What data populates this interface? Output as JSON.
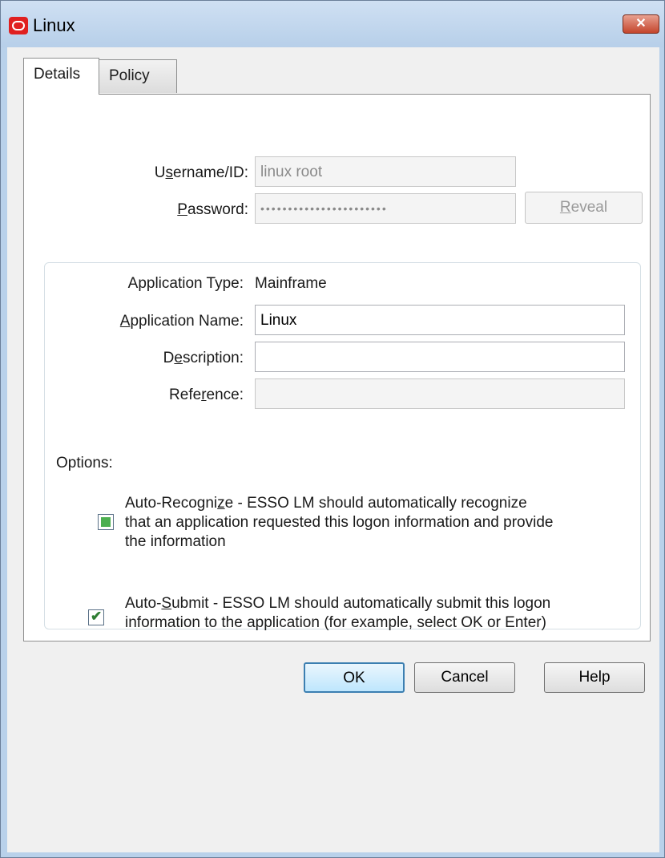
{
  "window": {
    "title": "Linux",
    "close_label": "✕"
  },
  "tabs": [
    {
      "label": "Details"
    },
    {
      "label": "Policy"
    }
  ],
  "details": {
    "username_label_pre": "U",
    "username_label_ul": "s",
    "username_label_post": "ername/ID:",
    "username_value": "linux root",
    "password_label_ul": "P",
    "password_label_post": "assword:",
    "password_value": "•••••••••••••••••••••••",
    "reveal_ul": "R",
    "reveal_post": "eveal"
  },
  "application": {
    "type_label": "Application Type:",
    "type_value": "Mainframe",
    "name_label_ul": "A",
    "name_label_post": "pplication Name:",
    "name_value": "Linux",
    "description_label_pre": "D",
    "description_label_ul": "e",
    "description_label_post": "scription:",
    "description_value": "",
    "reference_label_pre": "Refe",
    "reference_label_ul": "r",
    "reference_label_post": "ence:",
    "reference_value": ""
  },
  "options": {
    "heading": "Options:",
    "auto_recognize": {
      "line1_pre": "Auto-Recogni",
      "line1_ul": "z",
      "line1_post": "e - ESSO LM should automatically recognize",
      "line2": "that an application requested this logon information and provide",
      "line3": "the information",
      "state": "indeterminate"
    },
    "auto_submit": {
      "line1_pre": "Auto-",
      "line1_ul": "S",
      "line1_post": "ubmit - ESSO LM should automatically submit this logon",
      "line2": "information to the application (for example, select OK or Enter)",
      "checked": true,
      "check_glyph": "✔"
    }
  },
  "footer": {
    "ok_label": "OK",
    "cancel_label": "Cancel",
    "help_label": "Help"
  }
}
